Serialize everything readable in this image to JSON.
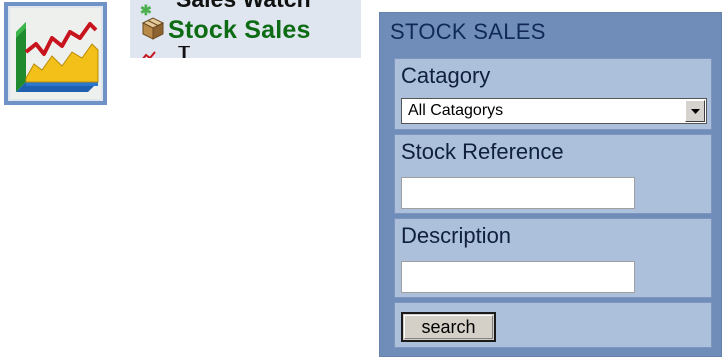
{
  "menu": {
    "partial_item_top": "Sales Watch",
    "main_item_label": "Stock Sales",
    "partial_item_bottom": "T"
  },
  "panel": {
    "title": "STOCK SALES",
    "catagory": {
      "label": "Catagory",
      "selected": "All Catagorys"
    },
    "stock_reference": {
      "label": "Stock Reference",
      "value": ""
    },
    "description": {
      "label": "Description",
      "value": ""
    },
    "search_button_label": "search"
  },
  "colors": {
    "panel_bg": "#6f8db8",
    "field_bg": "#acc0dc",
    "menu_label_green": "#0d6b14",
    "icon_frame": "#6f93c6"
  },
  "icons": [
    "stock-chart-icon",
    "box-icon",
    "star-icon",
    "chevron-down-icon"
  ]
}
